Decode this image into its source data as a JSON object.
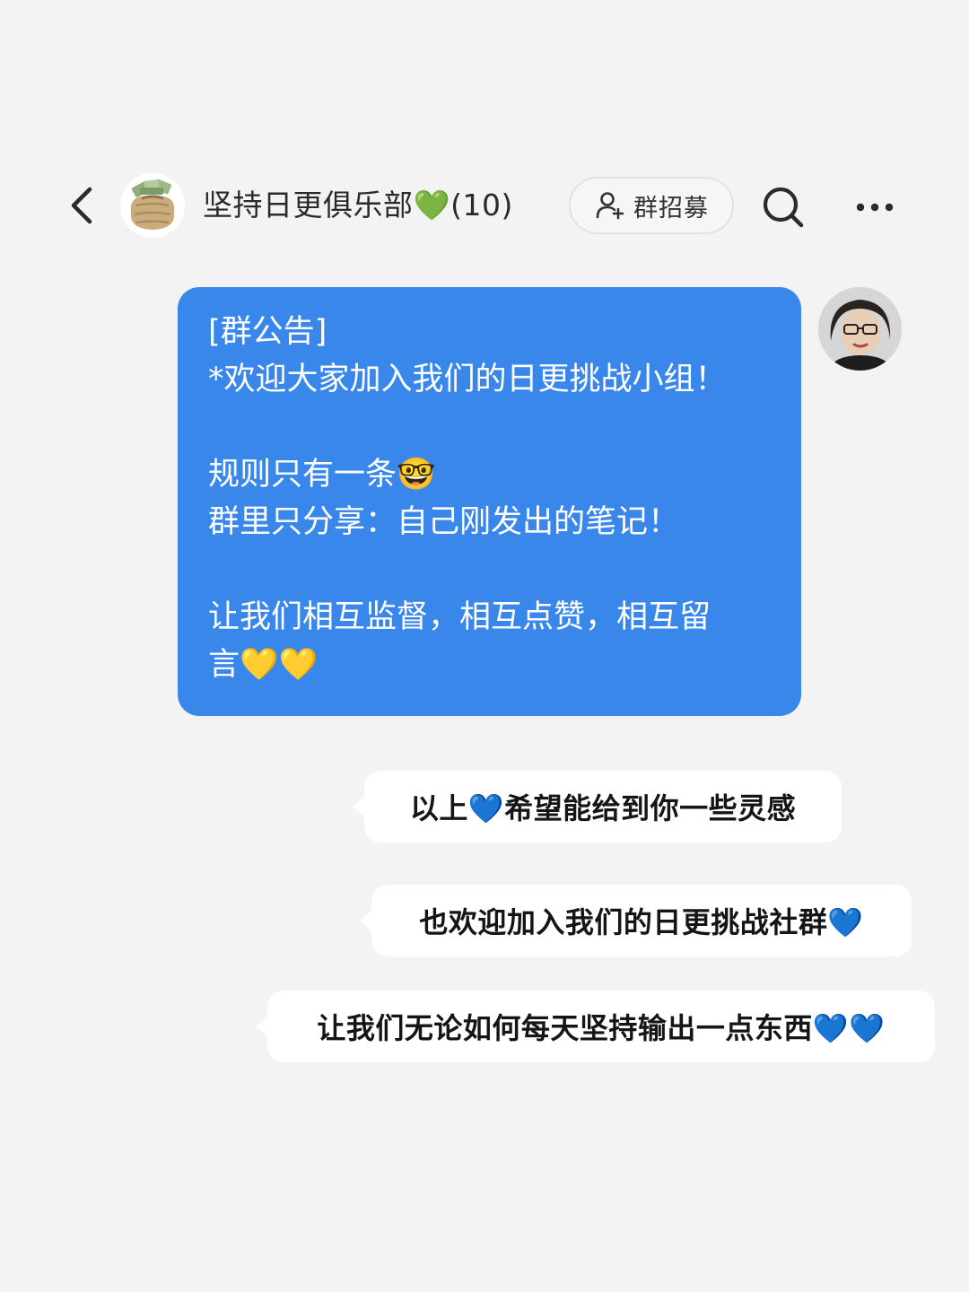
{
  "header": {
    "back_icon": "chevron-left-icon",
    "group_avatar_icon": "money-bag-icon",
    "group_title": "坚持日更俱乐部💚(10)",
    "recruit_icon": "add-person-icon",
    "recruit_label": "群招募",
    "search_icon": "search-icon",
    "more_icon": "more-dots-icon"
  },
  "announcement": {
    "tag": "[群公告]",
    "line1": "*欢迎大家加入我们的日更挑战小组！",
    "line2": "规则只有一条🤓",
    "line3": "群里只分享：自己刚发出的笔记！",
    "line4": "让我们相互监督，相互点赞，相互留",
    "line5": "言💛💛"
  },
  "messages": [
    "以上💙希望能给到你一些灵感",
    "也欢迎加入我们的日更挑战社群💙",
    "让我们无论如何每天坚持输出一点东西💙💙"
  ],
  "colors": {
    "background": "#f3f3f3",
    "announcement_bubble": "#3a87ec",
    "message_bubble": "#ffffff",
    "text_dark": "#151515"
  }
}
